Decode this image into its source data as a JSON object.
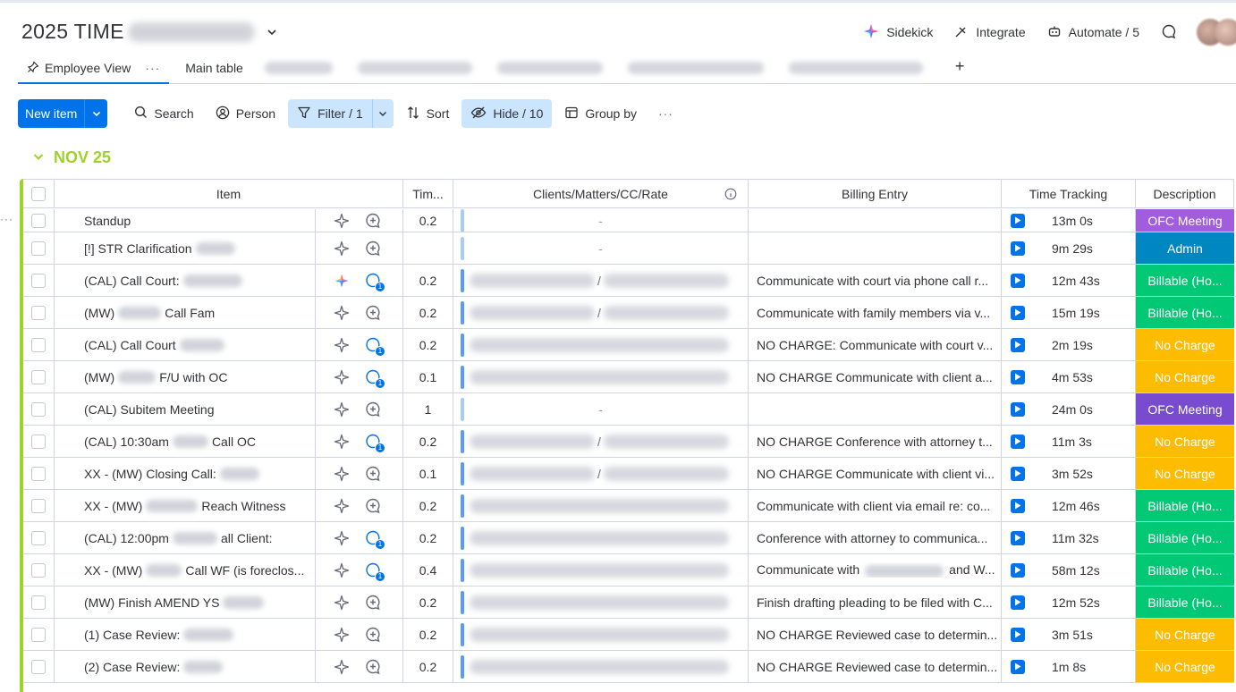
{
  "board": {
    "title": "2025 TIME"
  },
  "top_actions": [
    {
      "label": "Sidekick",
      "icon": "sidekick-sparkle-icon"
    },
    {
      "label": "Integrate",
      "icon": "integrate-plug-icon"
    },
    {
      "label": "Automate / 5",
      "icon": "robot-icon"
    }
  ],
  "tabs": {
    "active": "Employee View",
    "second": "Main table",
    "add": "+"
  },
  "toolbar": {
    "new_item": "New item",
    "search": "Search",
    "person": "Person",
    "filter": "Filter / 1",
    "sort": "Sort",
    "hide": "Hide / 10",
    "group_by": "Group by"
  },
  "group": {
    "title": "NOV 25",
    "color": "#9cd326"
  },
  "columns": {
    "item": "Item",
    "time": "Tim...",
    "clients": "Clients/Matters/CC/Rate",
    "billing": "Billing Entry",
    "tracking": "Time Tracking",
    "description": "Description"
  },
  "status_colors": {
    "OFC Meeting": "#a25ddc",
    "Admin": "#0086c0",
    "Billable (Ho...": "#00c875",
    "No Charge": "#fdbc00",
    "OFC Meeting dark": "#784bd1"
  },
  "rows": [
    {
      "item": "Standup",
      "item_blur": 0,
      "ai": false,
      "updates": false,
      "time": "0.2",
      "client": "-",
      "billing": "",
      "tracking": "13m 0s",
      "desc": "OFC Meeting",
      "desc_color": "#a25ddc"
    },
    {
      "item": "[!] STR Clarification",
      "item_blur": 44,
      "ai": false,
      "updates": false,
      "time": "",
      "client": "-",
      "billing": "",
      "tracking": "9m 29s",
      "desc": "Admin",
      "desc_color": "#0086c0"
    },
    {
      "item": "(CAL) Call Court:",
      "item_blur": 66,
      "ai": true,
      "updates": true,
      "time": "0.2",
      "client": "blur-sep",
      "billing": "Communicate with court via phone call r...",
      "tracking": "12m 43s",
      "desc": "Billable (Ho...",
      "desc_color": "#00c875"
    },
    {
      "item": "(MW)",
      "item_post": "Call Fam",
      "item_blur": 48,
      "ai": false,
      "updates": false,
      "time": "0.2",
      "client": "blur-sep2",
      "billing": "Communicate with family members via v...",
      "tracking": "15m 19s",
      "desc": "Billable (Ho...",
      "desc_color": "#00c875"
    },
    {
      "item": "(CAL) Call Court",
      "item_blur": 50,
      "ai": false,
      "updates": true,
      "time": "0.2",
      "client": "blur-dot",
      "billing": "NO CHARGE: Communicate with court v...",
      "tracking": "2m 19s",
      "desc": "No Charge",
      "desc_color": "#fdbc00"
    },
    {
      "item": "(MW)",
      "item_post": "F/U with OC",
      "item_blur": 42,
      "ai": false,
      "updates": true,
      "time": "0.1",
      "client": "blur",
      "billing": "NO CHARGE Communicate with client a...",
      "tracking": "4m 53s",
      "desc": "No Charge",
      "desc_color": "#fdbc00"
    },
    {
      "item": "(CAL) Subitem Meeting",
      "item_blur": 0,
      "ai": false,
      "updates": false,
      "time": "1",
      "client": "-",
      "billing": "",
      "tracking": "24m 0s",
      "desc": "OFC Meeting",
      "desc_color": "#784bd1"
    },
    {
      "item": "(CAL) 10:30am",
      "item_post": "Call OC",
      "item_blur": 40,
      "ai": false,
      "updates": true,
      "time": "0.2",
      "client": "blur-sep",
      "billing": "NO CHARGE Conference with attorney t...",
      "tracking": "11m 3s",
      "desc": "No Charge",
      "desc_color": "#fdbc00"
    },
    {
      "item": "XX - (MW) Closing Call:",
      "item_blur": 44,
      "ai": false,
      "updates": false,
      "time": "0.1",
      "client": "blur-sep",
      "billing": "NO CHARGE Communicate with client vi...",
      "tracking": "3m 52s",
      "desc": "No Charge",
      "desc_color": "#fdbc00"
    },
    {
      "item": "XX - (MW)",
      "item_post": "Reach Witness",
      "item_blur": 58,
      "ai": false,
      "updates": false,
      "time": "0.2",
      "client": "blur",
      "billing": "Communicate with client via email re: co...",
      "tracking": "12m 46s",
      "desc": "Billable (Ho...",
      "desc_color": "#00c875"
    },
    {
      "item": "(CAL) 12:00pm",
      "item_post": "all Client:",
      "item_blur": 50,
      "ai": false,
      "updates": true,
      "time": "0.2",
      "client": "blur",
      "billing": "Conference with attorney to communica...",
      "tracking": "11m 32s",
      "desc": "Billable (Ho...",
      "desc_color": "#00c875"
    },
    {
      "item": "XX - (MW)",
      "item_post": "Call WF (is foreclos...",
      "item_blur": 40,
      "ai": false,
      "updates": true,
      "time": "0.4",
      "client": "blur",
      "billing": "Communicate with",
      "billing_post": "and W...",
      "tracking": "58m 12s",
      "desc": "Billable (Ho...",
      "desc_color": "#00c875"
    },
    {
      "item": "(MW) Finish AMEND YS",
      "item_blur": 46,
      "ai": false,
      "updates": false,
      "time": "0.2",
      "client": "blur",
      "billing": "Finish drafting pleading to be filed with C...",
      "tracking": "12m 52s",
      "desc": "Billable (Ho...",
      "desc_color": "#00c875"
    },
    {
      "item": "(1) Case Review:",
      "item_blur": 56,
      "ai": false,
      "updates": false,
      "time": "0.2",
      "client": "blur",
      "billing": "NO CHARGE Reviewed case to determin...",
      "tracking": "3m 51s",
      "desc": "No Charge",
      "desc_color": "#fdbc00"
    },
    {
      "item": "(2) Case Review:",
      "item_blur": 44,
      "ai": false,
      "updates": false,
      "time": "0.2",
      "client": "blur",
      "billing": "NO CHARGE Reviewed case to determin...",
      "tracking": "1m 8s",
      "desc": "No Charge",
      "desc_color": "#fdbc00"
    }
  ]
}
